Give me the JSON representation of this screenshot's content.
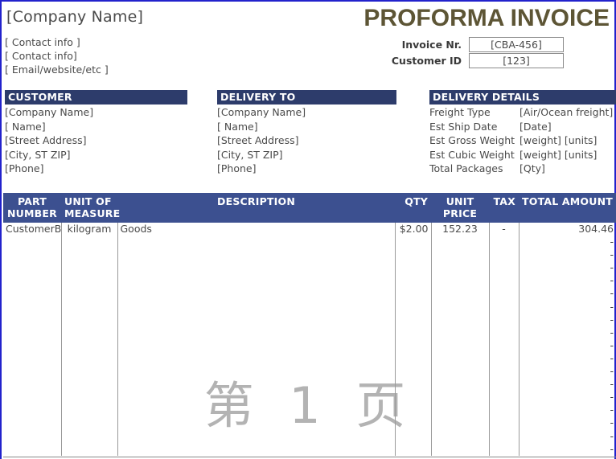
{
  "header": {
    "company_name": "[Company Name]",
    "contact_lines": [
      "[ Contact info ]",
      "[ Contact info]",
      "[ Email/website/etc ]"
    ],
    "doc_title": "PROFORMA INVOICE",
    "meta": [
      {
        "label": "Invoice Nr.",
        "value": "[CBA-456]"
      },
      {
        "label": "Customer ID",
        "value": "[123]"
      }
    ]
  },
  "panels": {
    "customer": {
      "title": "CUSTOMER",
      "lines": [
        "[Company Name]",
        "[ Name]",
        "[Street Address]",
        "[City, ST  ZIP]",
        "[Phone]"
      ]
    },
    "delivery_to": {
      "title": "DELIVERY TO",
      "lines": [
        "[Company Name]",
        "[ Name]",
        "[Street Address]",
        "[City, ST  ZIP]",
        "[Phone]"
      ]
    },
    "delivery_details": {
      "title": "DELIVERY DETAILS",
      "rows": [
        {
          "key": "Freight Type",
          "value": "[Air/Ocean freight]"
        },
        {
          "key": "Est Ship Date",
          "value": "[Date]"
        },
        {
          "key": "Est Gross Weight",
          "value": "[weight] [units]"
        },
        {
          "key": "Est Cubic Weight",
          "value": "[weight] [units]"
        },
        {
          "key": "Total Packages",
          "value": "[Qty]"
        }
      ]
    }
  },
  "items_table": {
    "columns": [
      "PART NUMBER",
      "UNIT OF MEASURE",
      "DESCRIPTION",
      "QTY",
      "UNIT PRICE",
      "TAX",
      "TOTAL AMOUNT"
    ],
    "columns_split": [
      {
        "line1": "PART",
        "line2": "NUMBER"
      },
      {
        "line1": "UNIT OF",
        "line2": "MEASURE"
      },
      {
        "line1": "DESCRIPTION",
        "line2": ""
      },
      {
        "line1": "QTY",
        "line2": ""
      },
      {
        "line1": "UNIT",
        "line2": "PRICE"
      },
      {
        "line1": "TAX",
        "line2": ""
      },
      {
        "line1": "TOTAL AMOUNT",
        "line2": ""
      }
    ],
    "rows": [
      {
        "part_number": "CustomerB",
        "unit_of_measure": "kilogram",
        "description": "Goods",
        "qty": "$2.00",
        "unit_price": "152.23",
        "tax": "-",
        "total_amount": "304.46"
      }
    ],
    "empty_row_total_placeholder": "-",
    "empty_row_count": 17
  },
  "watermark": {
    "text": "第 1 页"
  },
  "colors": {
    "panel_header_bg": "#2d3c6b",
    "table_header_bg": "#3c5090",
    "title_text": "#5d5535",
    "page_border": "#2222cc",
    "watermark": "#b3b3b3"
  }
}
